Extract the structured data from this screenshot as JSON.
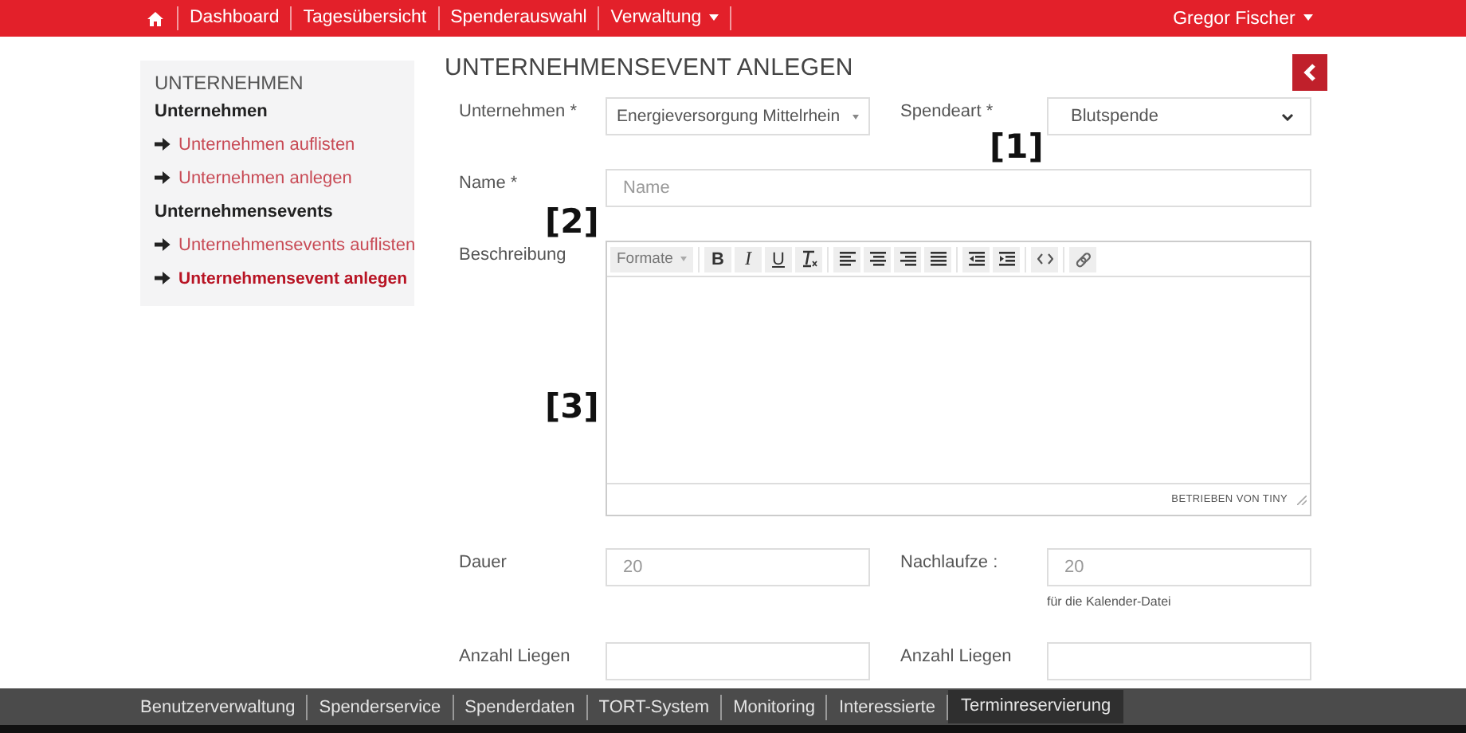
{
  "navbar": {
    "items": [
      {
        "kind": "home"
      },
      {
        "kind": "link",
        "label": "Dashboard"
      },
      {
        "kind": "link",
        "label": "Tagesübersicht"
      },
      {
        "kind": "link",
        "label": "Spenderauswahl"
      },
      {
        "kind": "dropdown",
        "label": "Verwaltung"
      }
    ],
    "user": "Gregor Fischer"
  },
  "sidebar": {
    "title": "UNTERNEHMEN",
    "items": [
      {
        "kind": "heading",
        "label": "Unternehmen"
      },
      {
        "kind": "link",
        "label": "Unternehmen auflisten",
        "selected": false
      },
      {
        "kind": "link",
        "label": "Unternehmen anlegen",
        "selected": false
      },
      {
        "kind": "heading",
        "label": "Unternehmensevents"
      },
      {
        "kind": "link",
        "label": "Unternehmensevents auflisten",
        "selected": false
      },
      {
        "kind": "link",
        "label": "Unternehmensevent anlegen",
        "selected": true
      }
    ]
  },
  "form": {
    "title": "UNTERNEHMENSEVENT ANLEGEN",
    "row_1": [
      {
        "label": "Unternehmen *",
        "kind": "select2",
        "value": "Energieversorgung Mittelrhein"
      },
      {
        "label": "Spendeart *",
        "kind": "select",
        "value": "Blutspende"
      }
    ],
    "name": {
      "label": "Name *",
      "placeholder": "Name"
    },
    "description": {
      "label": "Beschreibung",
      "format_label": "Formate",
      "text_buttons": [
        "B",
        "I",
        "U"
      ],
      "status": "BETRIEBEN VON TINY"
    },
    "row_3": [
      {
        "label": "Dauer",
        "placeholder": "20"
      },
      {
        "label": "Nachlaufze :",
        "placeholder": "20",
        "hint": "für die Kalender-Datei"
      }
    ],
    "row_4": [
      {
        "label": "Anzahl Liegen"
      },
      {
        "label": "Anzahl Liegen"
      }
    ]
  },
  "annotations": [
    {
      "label": "[1]"
    },
    {
      "label": "[2]"
    },
    {
      "label": "[3]"
    }
  ],
  "bottom_bar": [
    {
      "label": "Benutzerverwaltung",
      "selected": false
    },
    {
      "label": "Spenderservice",
      "selected": false
    },
    {
      "label": "Spenderdaten",
      "selected": false
    },
    {
      "label": "TORT-System",
      "selected": false
    },
    {
      "label": "Monitoring",
      "selected": false
    },
    {
      "label": "Interessierte",
      "selected": false
    },
    {
      "label": "Terminreservierung",
      "selected": true
    }
  ]
}
